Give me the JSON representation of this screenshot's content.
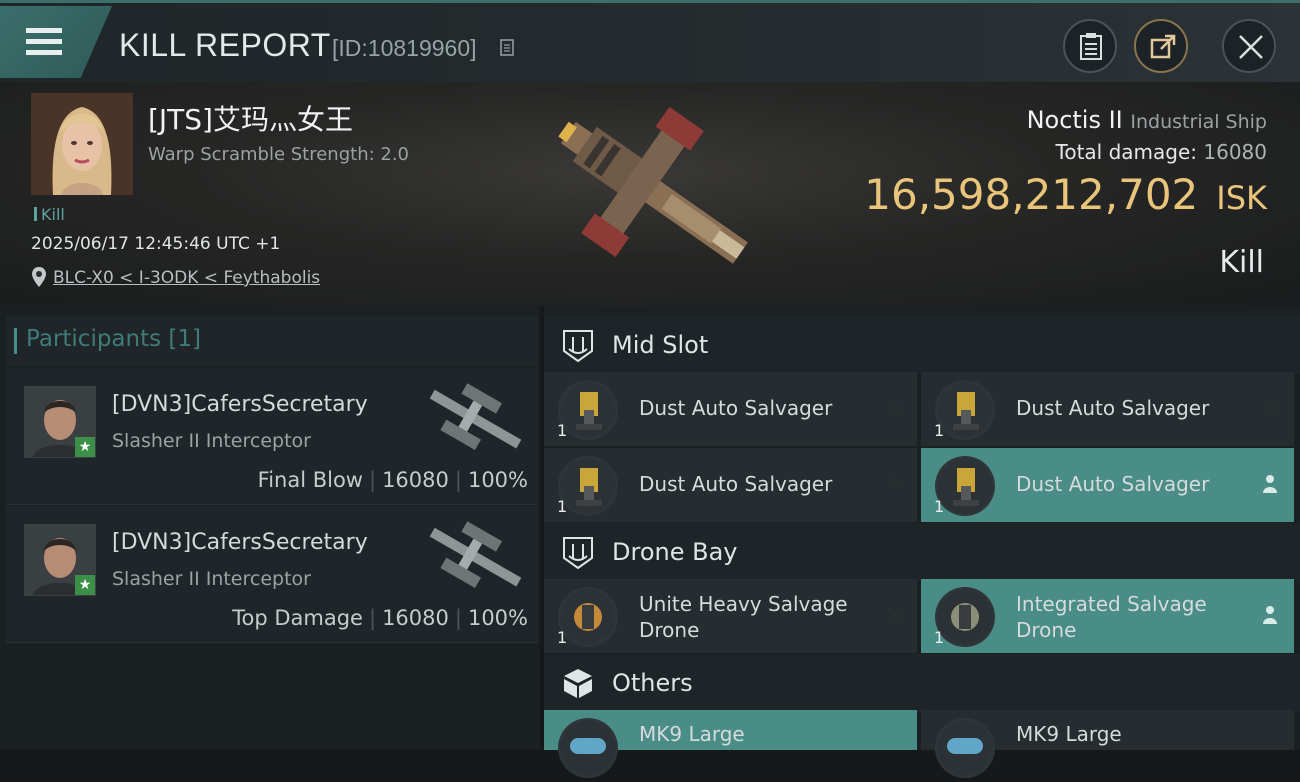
{
  "header": {
    "title": "KILL REPORT",
    "report_id": "[ID:10819960]"
  },
  "victim": {
    "name": "[JTS]艾玛灬女王",
    "subtitle": "Warp Scramble Strength: 2.0",
    "tag": "Kill",
    "datetime": "2025/06/17 12:45:46 UTC +1",
    "location": "BLC-X0 < I-3ODK < Feythabolis",
    "ship_name": "Noctis II",
    "ship_class": "Industrial Ship",
    "total_damage_label": "Total damage:",
    "total_damage": "16080",
    "isk_value": "16,598,212,702",
    "isk_unit": "ISK",
    "kill_type": "Kill"
  },
  "participants": {
    "label": "Participants",
    "count": "[1]",
    "rows": [
      {
        "name": "[DVN3]CafersSecretary",
        "ship": "Slasher II Interceptor",
        "role": "Final Blow",
        "damage": "16080",
        "percent": "100%"
      },
      {
        "name": "[DVN3]CafersSecretary",
        "ship": "Slasher II Interceptor",
        "role": "Top Damage",
        "damage": "16080",
        "percent": "100%"
      }
    ]
  },
  "fitting": {
    "mid_slot": {
      "label": "Mid Slot",
      "items": [
        {
          "name": "Dust Auto Salvager",
          "qty": "1",
          "state": "destroyed"
        },
        {
          "name": "Dust Auto Salvager",
          "qty": "1",
          "state": "destroyed"
        },
        {
          "name": "Dust Auto Salvager",
          "qty": "1",
          "state": "destroyed"
        },
        {
          "name": "Dust Auto Salvager",
          "qty": "1",
          "state": "dropped"
        }
      ]
    },
    "drone_bay": {
      "label": "Drone Bay",
      "items": [
        {
          "name": "Unite Heavy Salvage Drone",
          "line1": "Unite Heavy Salvage",
          "line2": "Drone",
          "qty": "1",
          "state": "destroyed"
        },
        {
          "name": "Integrated Salvage Drone",
          "line1": "Integrated Salvage",
          "line2": "Drone",
          "qty": "1",
          "state": "dropped"
        }
      ]
    },
    "others": {
      "label": "Others",
      "items": [
        {
          "name": "MK9 Large",
          "state": "dropped"
        },
        {
          "name": "MK9 Large",
          "state": "destroyed"
        }
      ]
    }
  },
  "colors": {
    "accent": "#4a8c86",
    "isk": "#e8c57a",
    "panel": "#1b2023"
  }
}
